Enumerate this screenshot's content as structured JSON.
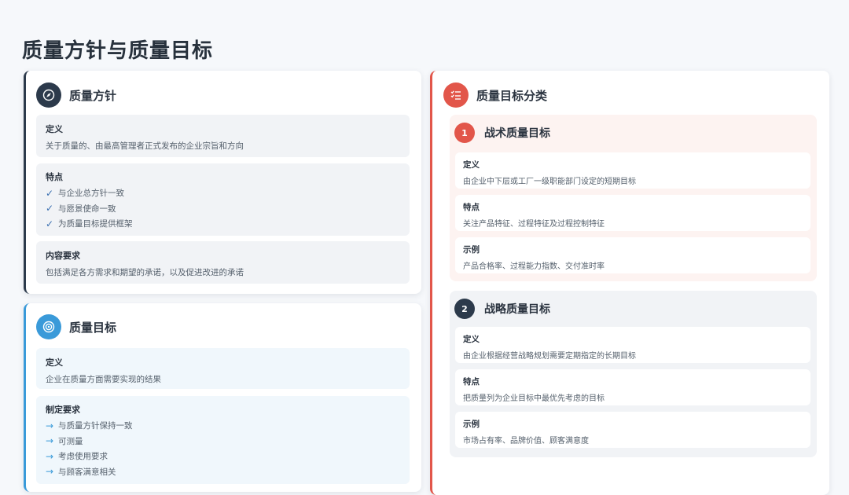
{
  "page": {
    "title": "质量方针与质量目标"
  },
  "policy": {
    "title": "质量方针",
    "icon": "compass-icon",
    "definition": {
      "label": "定义",
      "text": "关于质量的、由最高管理者正式发布的企业宗旨和方向"
    },
    "features": {
      "label": "特点",
      "items": [
        "与企业总方针一致",
        "与愿景使命一致",
        "为质量目标提供框架"
      ]
    },
    "content": {
      "label": "内容要求",
      "text": "包括满足各方需求和期望的承诺，以及促进改进的承诺"
    }
  },
  "objectives": {
    "title": "质量目标",
    "icon": "target-icon",
    "definition": {
      "label": "定义",
      "text": "企业在质量方面需要实现的结果"
    },
    "requirements": {
      "label": "制定要求",
      "items": [
        "与质量方针保持一致",
        "可测量",
        "考虑使用要求",
        "与顾客满意相关"
      ]
    }
  },
  "classification": {
    "title": "质量目标分类",
    "icon": "list-check-icon",
    "tactical": {
      "number": "1",
      "title": "战术质量目标",
      "definition": {
        "label": "定义",
        "text": "由企业中下层或工厂一级职能部门设定的短期目标"
      },
      "features": {
        "label": "特点",
        "text": "关注产品特征、过程特征及过程控制特征"
      },
      "example": {
        "label": "示例",
        "text": "产品合格率、过程能力指数、交付准时率"
      }
    },
    "strategic": {
      "number": "2",
      "title": "战略质量目标",
      "definition": {
        "label": "定义",
        "text": "由企业根据经营战略规划需要定期指定的长期目标"
      },
      "features": {
        "label": "特点",
        "text": "把质量列为企业目标中最优先考虑的目标"
      },
      "example": {
        "label": "示例",
        "text": "市场占有率、品牌价值、顾客满意度"
      }
    }
  },
  "colors": {
    "dark": "#2c3a4b",
    "blue": "#3a9ad9",
    "red": "#e2564a"
  }
}
